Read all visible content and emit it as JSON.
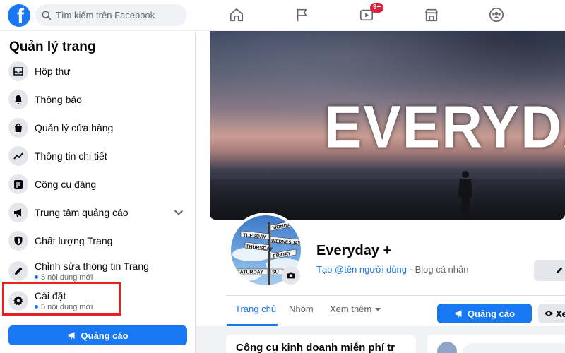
{
  "topbar": {
    "logo_letter": "f",
    "search_placeholder": "Tìm kiếm trên Facebook",
    "nav_icons": [
      "home-icon",
      "flag-icon",
      "watch-icon",
      "marketplace-icon",
      "groups-icon"
    ],
    "watch_badge": "9+"
  },
  "sidebar": {
    "title": "Quản lý trang",
    "items": [
      {
        "label": "Hộp thư",
        "icon": "inbox-icon"
      },
      {
        "label": "Thông báo",
        "icon": "bell-icon"
      },
      {
        "label": "Quản lý cửa hàng",
        "icon": "shopping-bag-icon"
      },
      {
        "label": "Thông tin chi tiết",
        "icon": "insights-icon"
      },
      {
        "label": "Công cụ đăng",
        "icon": "publishing-tools-icon"
      },
      {
        "label": "Trung tâm quảng cáo",
        "icon": "megaphone-icon"
      },
      {
        "label": "Chất lượng Trang",
        "icon": "shield-icon"
      },
      {
        "label": "Chỉnh sửa thông tin Trang",
        "sub": "5 nội dung mới",
        "icon": "pencil-icon"
      },
      {
        "label": "Cài đặt",
        "sub": "5 nội dung mới",
        "icon": "gear-icon"
      }
    ],
    "ad_button": "Quảng cáo"
  },
  "cover": {
    "text": "EVERYDA"
  },
  "profile": {
    "name": "Everyday +",
    "username_link": "Tạo @tên người dùng",
    "category": " · Blog cá nhân",
    "signpost_words": [
      "TUESDAY",
      "MONDAY",
      "THURSDAY",
      "WEDNESDAY",
      "FRIDAY",
      "SATURDAY",
      "SU"
    ]
  },
  "tabs": [
    {
      "label": "Trang chủ",
      "active": true
    },
    {
      "label": "Nhóm",
      "active": false
    },
    {
      "label": "Xem thêm",
      "active": false
    }
  ],
  "actions": {
    "ad_button": "Quảng cáo",
    "view_button": "Xe"
  },
  "bottom": {
    "card_title": "Công cụ kinh doanh miễn phí tr"
  },
  "colors": {
    "brand_blue": "#1877f2",
    "highlight_red": "#e8201e",
    "badge_red": "#e41e3f"
  }
}
